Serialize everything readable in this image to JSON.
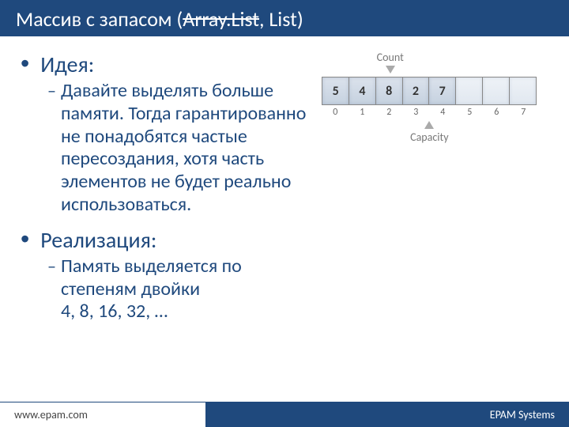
{
  "header": {
    "title_part1": "Массив с запасом (",
    "title_strike": "Array.List",
    "title_part2": ", List)"
  },
  "idea": {
    "label": "Идея:",
    "text": "Давайте выделять больше памяти. Тогда гарантированно не понадобятся частые пересоздания, хотя часть элементов не будет реально использоваться."
  },
  "impl": {
    "label": "Реализация:",
    "line1": "Память выделяется по степеням двойки",
    "line2": "4, 8, 16, 32, …"
  },
  "diagram": {
    "count_label": "Count",
    "capacity_label": "Capacity",
    "cells": [
      "5",
      "4",
      "8",
      "2",
      "7",
      "",
      "",
      ""
    ],
    "idx": [
      "0",
      "1",
      "2",
      "3",
      "4",
      "5",
      "6",
      "7"
    ]
  },
  "footer": {
    "url": "www.epam.com",
    "brand": "EPAM Systems"
  }
}
